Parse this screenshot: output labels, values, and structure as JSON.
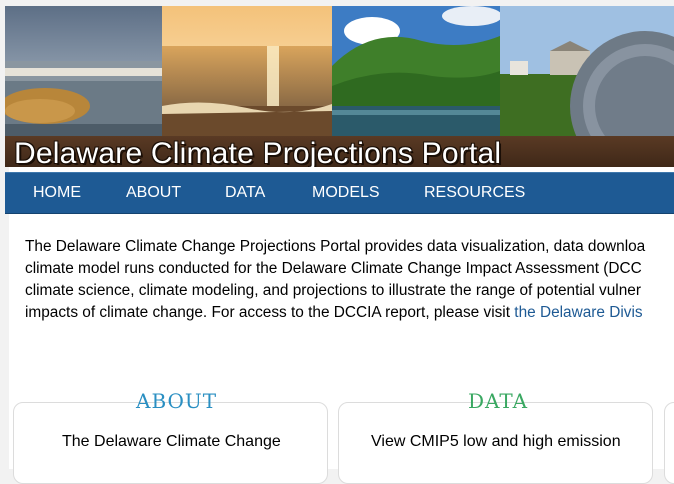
{
  "banner": {
    "title": "Delaware Climate Projections Portal",
    "photos": [
      "marsh-photo",
      "beach-sunset-photo",
      "river-forest-photo",
      "farm-barn-photo",
      "state-seal-image"
    ]
  },
  "nav": {
    "items": [
      {
        "label": "HOME"
      },
      {
        "label": "ABOUT"
      },
      {
        "label": "DATA"
      },
      {
        "label": "MODELS"
      },
      {
        "label": "RESOURCES"
      }
    ]
  },
  "intro": {
    "lines": [
      "The Delaware Climate Change Projections Portal provides data visualization, data downloa",
      "climate model runs conducted for the Delaware Climate Change Impact Assessment (DCC",
      "climate science, climate modeling, and projections to illustrate the range of potential vulner",
      "impacts of climate change. For access to the DCCIA report, please visit "
    ],
    "link_text": "the Delaware Divis"
  },
  "cards": [
    {
      "title": "ABOUT",
      "text": "The Delaware Climate Change",
      "color": "#2a8fc2"
    },
    {
      "title": "DATA",
      "text": "View CMIP5 low and high emission",
      "color": "#3aa862"
    }
  ],
  "colors": {
    "nav_bg": "#1e5a94",
    "link": "#1e5a94",
    "about_title": "#2a8fc2",
    "data_title": "#3aa862"
  }
}
